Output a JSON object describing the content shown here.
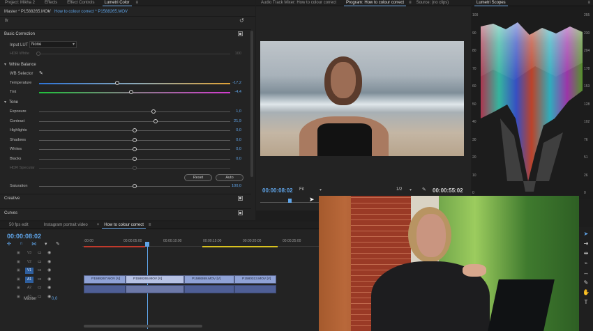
{
  "left_panel": {
    "tabs": [
      "Project: Mikha 2",
      "Effects",
      "Effect Controls",
      "Lumetri Color"
    ],
    "active_tab": 3,
    "clip_selector": "Master * P1588265.MOV",
    "clip_selector_seq": "How to colour correct * P1588265.MOV",
    "fx": "fx",
    "basic_correction": "Basic Correction",
    "input_lut_label": "Input LUT",
    "input_lut_value": "None",
    "hdr_white_label": "HDR White",
    "hdr_white_value": "100",
    "white_balance": "White Balance",
    "wb_selector": "WB Selector",
    "temperature": {
      "label": "Temperature",
      "value": "-17,2",
      "pos": 0.41
    },
    "tint": {
      "label": "Tint",
      "value": "-4,4",
      "pos": 0.48
    },
    "tone": "Tone",
    "sliders": [
      {
        "label": "Exposure",
        "value": "1,0",
        "pos": 0.6
      },
      {
        "label": "Contrast",
        "value": "21,9",
        "pos": 0.61
      },
      {
        "label": "Highlights",
        "value": "0,0",
        "pos": 0.5
      },
      {
        "label": "Shadows",
        "value": "0,0",
        "pos": 0.5
      },
      {
        "label": "Whites",
        "value": "0,0",
        "pos": 0.5
      },
      {
        "label": "Blacks",
        "value": "0,0",
        "pos": 0.5
      }
    ],
    "hdr_specular": "HDR Specular",
    "reset": "Reset",
    "auto": "Auto",
    "saturation": {
      "label": "Saturation",
      "value": "100,0",
      "pos": 0.5
    },
    "creative": "Creative",
    "curves": "Curves"
  },
  "program": {
    "tabs": [
      "Audio Track Mixer: How to colour correct",
      "Program: How to colour correct",
      "Source: (no clips)"
    ],
    "active_tab": 1,
    "timecode": "00:00:08:02",
    "fit": "Fit",
    "resolution": "1/2",
    "duration": "00:00:55:02"
  },
  "scopes": {
    "title": "Lumetri Scopes",
    "left_scale": [
      "100",
      "90",
      "80",
      "70",
      "60",
      "50",
      "40",
      "30",
      "20",
      "10",
      "0"
    ],
    "right_scale": [
      "255",
      "230",
      "204",
      "178",
      "153",
      "128",
      "102",
      "76",
      "51",
      "26",
      "0"
    ]
  },
  "timeline": {
    "tabs": [
      "50 fps edit",
      "Instagram portrait video",
      "How to colour correct"
    ],
    "active_tab": 2,
    "timecode": "00:00:08:02",
    "ruler": [
      ":00:00",
      "00:00:05:00",
      "00:00:10:00",
      "00:00:15:00",
      "00:00:20:00",
      "00:00:25:00",
      "00:00:30:00"
    ],
    "tracks": [
      "V3",
      "V2",
      "V1",
      "A1",
      "A2",
      "A3"
    ],
    "master": "Master",
    "master_value": "0,0",
    "clips": [
      "P1588267.MOV [V]",
      "P1588265.MOV [V]",
      "P1588268.MOV [V]",
      "P1580313.MOV [V]"
    ]
  },
  "colors": {
    "accent": "#5fa4e8",
    "panel": "#232323",
    "clip": "#8fa2d6"
  }
}
